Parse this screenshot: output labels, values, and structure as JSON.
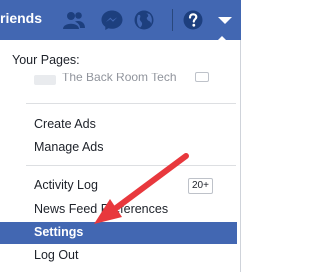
{
  "topbar": {
    "title": "riends",
    "icons": [
      "friend-requests-icon",
      "messenger-icon",
      "notifications-globe-icon",
      "help-icon",
      "account-menu-caret-icon"
    ]
  },
  "menu": {
    "pages_heading": "Your Pages:",
    "page_name": "The Back Room Tech",
    "items": {
      "create_ads": "Create Ads",
      "manage_ads": "Manage Ads",
      "activity_log": "Activity Log",
      "activity_badge": "20+",
      "news_feed": "News Feed Preferences",
      "settings": "Settings",
      "log_out": "Log Out"
    }
  },
  "colors": {
    "brand": "#4267b2",
    "highlight_arrow": "#e8383d"
  }
}
